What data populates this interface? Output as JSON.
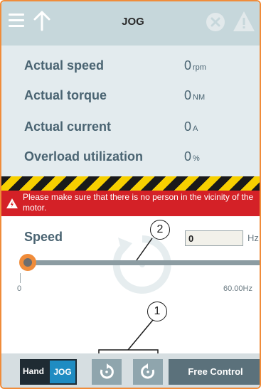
{
  "header": {
    "title": "JOG",
    "icons": [
      "menu-icon",
      "up-arrow-icon",
      "error-icon",
      "warning-icon"
    ]
  },
  "values": [
    {
      "label": "Actual speed",
      "value": "0",
      "unit": "rpm"
    },
    {
      "label": "Actual torque",
      "value": "0",
      "unit": "NM"
    },
    {
      "label": "Actual current",
      "value": "0",
      "unit": "A"
    },
    {
      "label": "Overload utilization",
      "value": "0",
      "unit": "%"
    }
  ],
  "warning": {
    "text": "Please make sure that there is no person in the vicinity of the motor."
  },
  "speed": {
    "label": "Speed",
    "input_value": "0",
    "unit": "Hz",
    "slider_min_label": "0",
    "slider_max_label": "60.00Hz",
    "slider_value": 0
  },
  "callouts": {
    "one": "1",
    "two": "2"
  },
  "toolbar": {
    "hand_label": "Hand",
    "jog_label": "JOG",
    "free_control_label": "Free Control"
  },
  "colors": {
    "accent": "#f08c3a",
    "header_bg": "#c6d7db",
    "warning_red": "#d42127",
    "jog_blue": "#1f8cc2"
  }
}
